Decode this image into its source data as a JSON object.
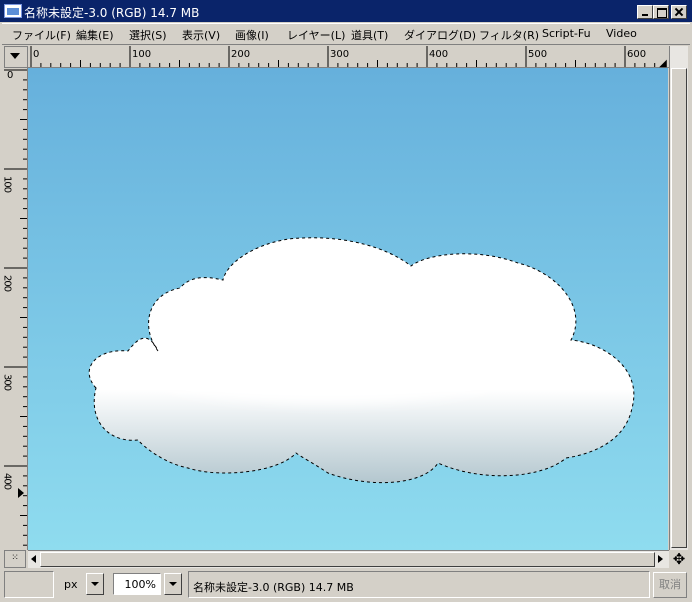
{
  "window": {
    "title": "名称未設定-3.0 (RGB) 14.7 MB"
  },
  "menu": [
    "ファイル(F)",
    "編集(E)",
    "選択(S)",
    "表示(V)",
    "画像(I)",
    "レイヤー(L)",
    "道具(T)",
    "ダイアログ(D)",
    "フィルタ(R)",
    "Script-Fu",
    "Video"
  ],
  "rulers": {
    "horizontal_labels": [
      "0",
      "100",
      "200",
      "300",
      "400",
      "500",
      "600"
    ],
    "vertical_labels": [
      "0",
      "100",
      "200",
      "300",
      "400"
    ]
  },
  "canvas": {
    "sky_top_color": "#66b0dc",
    "sky_bottom_color": "#8fdcef",
    "cloud_color": "#ffffff",
    "cloud_shadow_color": "#b4c7cf",
    "selection": "marching-ants"
  },
  "statusbar": {
    "unit": "px",
    "zoom": "100%",
    "text": "名称未設定-3.0 (RGB) 14.7 MB",
    "cancel_label": "取消"
  }
}
